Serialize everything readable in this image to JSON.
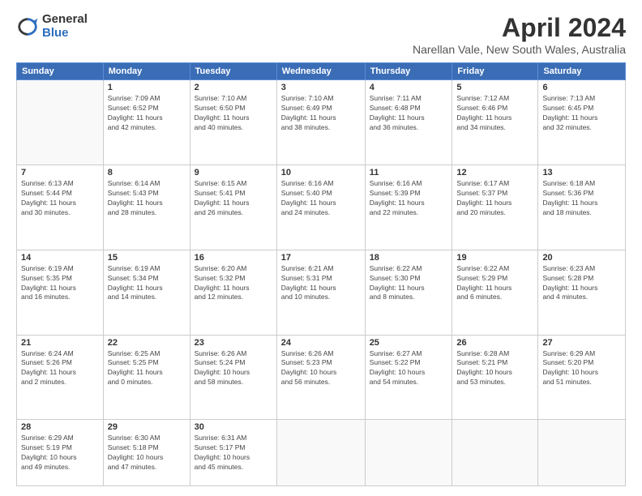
{
  "logo": {
    "general": "General",
    "blue": "Blue"
  },
  "title": "April 2024",
  "location": "Narellan Vale, New South Wales, Australia",
  "days_of_week": [
    "Sunday",
    "Monday",
    "Tuesday",
    "Wednesday",
    "Thursday",
    "Friday",
    "Saturday"
  ],
  "weeks": [
    [
      {
        "day": "",
        "info": ""
      },
      {
        "day": "1",
        "info": "Sunrise: 7:09 AM\nSunset: 6:52 PM\nDaylight: 11 hours\nand 42 minutes."
      },
      {
        "day": "2",
        "info": "Sunrise: 7:10 AM\nSunset: 6:50 PM\nDaylight: 11 hours\nand 40 minutes."
      },
      {
        "day": "3",
        "info": "Sunrise: 7:10 AM\nSunset: 6:49 PM\nDaylight: 11 hours\nand 38 minutes."
      },
      {
        "day": "4",
        "info": "Sunrise: 7:11 AM\nSunset: 6:48 PM\nDaylight: 11 hours\nand 36 minutes."
      },
      {
        "day": "5",
        "info": "Sunrise: 7:12 AM\nSunset: 6:46 PM\nDaylight: 11 hours\nand 34 minutes."
      },
      {
        "day": "6",
        "info": "Sunrise: 7:13 AM\nSunset: 6:45 PM\nDaylight: 11 hours\nand 32 minutes."
      }
    ],
    [
      {
        "day": "7",
        "info": "Sunrise: 6:13 AM\nSunset: 5:44 PM\nDaylight: 11 hours\nand 30 minutes."
      },
      {
        "day": "8",
        "info": "Sunrise: 6:14 AM\nSunset: 5:43 PM\nDaylight: 11 hours\nand 28 minutes."
      },
      {
        "day": "9",
        "info": "Sunrise: 6:15 AM\nSunset: 5:41 PM\nDaylight: 11 hours\nand 26 minutes."
      },
      {
        "day": "10",
        "info": "Sunrise: 6:16 AM\nSunset: 5:40 PM\nDaylight: 11 hours\nand 24 minutes."
      },
      {
        "day": "11",
        "info": "Sunrise: 6:16 AM\nSunset: 5:39 PM\nDaylight: 11 hours\nand 22 minutes."
      },
      {
        "day": "12",
        "info": "Sunrise: 6:17 AM\nSunset: 5:37 PM\nDaylight: 11 hours\nand 20 minutes."
      },
      {
        "day": "13",
        "info": "Sunrise: 6:18 AM\nSunset: 5:36 PM\nDaylight: 11 hours\nand 18 minutes."
      }
    ],
    [
      {
        "day": "14",
        "info": "Sunrise: 6:19 AM\nSunset: 5:35 PM\nDaylight: 11 hours\nand 16 minutes."
      },
      {
        "day": "15",
        "info": "Sunrise: 6:19 AM\nSunset: 5:34 PM\nDaylight: 11 hours\nand 14 minutes."
      },
      {
        "day": "16",
        "info": "Sunrise: 6:20 AM\nSunset: 5:32 PM\nDaylight: 11 hours\nand 12 minutes."
      },
      {
        "day": "17",
        "info": "Sunrise: 6:21 AM\nSunset: 5:31 PM\nDaylight: 11 hours\nand 10 minutes."
      },
      {
        "day": "18",
        "info": "Sunrise: 6:22 AM\nSunset: 5:30 PM\nDaylight: 11 hours\nand 8 minutes."
      },
      {
        "day": "19",
        "info": "Sunrise: 6:22 AM\nSunset: 5:29 PM\nDaylight: 11 hours\nand 6 minutes."
      },
      {
        "day": "20",
        "info": "Sunrise: 6:23 AM\nSunset: 5:28 PM\nDaylight: 11 hours\nand 4 minutes."
      }
    ],
    [
      {
        "day": "21",
        "info": "Sunrise: 6:24 AM\nSunset: 5:26 PM\nDaylight: 11 hours\nand 2 minutes."
      },
      {
        "day": "22",
        "info": "Sunrise: 6:25 AM\nSunset: 5:25 PM\nDaylight: 11 hours\nand 0 minutes."
      },
      {
        "day": "23",
        "info": "Sunrise: 6:26 AM\nSunset: 5:24 PM\nDaylight: 10 hours\nand 58 minutes."
      },
      {
        "day": "24",
        "info": "Sunrise: 6:26 AM\nSunset: 5:23 PM\nDaylight: 10 hours\nand 56 minutes."
      },
      {
        "day": "25",
        "info": "Sunrise: 6:27 AM\nSunset: 5:22 PM\nDaylight: 10 hours\nand 54 minutes."
      },
      {
        "day": "26",
        "info": "Sunrise: 6:28 AM\nSunset: 5:21 PM\nDaylight: 10 hours\nand 53 minutes."
      },
      {
        "day": "27",
        "info": "Sunrise: 6:29 AM\nSunset: 5:20 PM\nDaylight: 10 hours\nand 51 minutes."
      }
    ],
    [
      {
        "day": "28",
        "info": "Sunrise: 6:29 AM\nSunset: 5:19 PM\nDaylight: 10 hours\nand 49 minutes."
      },
      {
        "day": "29",
        "info": "Sunrise: 6:30 AM\nSunset: 5:18 PM\nDaylight: 10 hours\nand 47 minutes."
      },
      {
        "day": "30",
        "info": "Sunrise: 6:31 AM\nSunset: 5:17 PM\nDaylight: 10 hours\nand 45 minutes."
      },
      {
        "day": "",
        "info": ""
      },
      {
        "day": "",
        "info": ""
      },
      {
        "day": "",
        "info": ""
      },
      {
        "day": "",
        "info": ""
      }
    ]
  ]
}
